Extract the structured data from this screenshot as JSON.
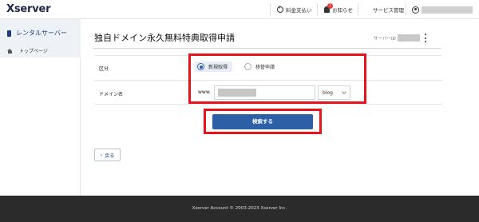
{
  "header": {
    "logo": "Xserver",
    "billing_label": "料金支払い",
    "billing_icon": "coin-icon",
    "notice_label": "お知らせ",
    "notice_badge": "1",
    "notice_icon": "bell-icon",
    "services_label": "サービス管理",
    "services_icon": "grid-icon",
    "user_icon": "user-icon"
  },
  "sidebar": {
    "section_label": "レンタルサーバー",
    "section_icon": "book-icon",
    "items": [
      {
        "label": "トップページ",
        "icon": "home-icon"
      }
    ]
  },
  "main": {
    "title": "独自ドメイン永久無料特典取得申請",
    "server_id_label": "サーバーID",
    "form": {
      "kind_label": "区分",
      "options": [
        {
          "label": "新規取得",
          "selected": true
        },
        {
          "label": "移管申請",
          "selected": false
        }
      ],
      "domain_label": "ドメイン名",
      "domain_prefix": "www.",
      "domain_value": "",
      "tld_selected": "blog"
    },
    "search_button": "検索する",
    "back_button": "戻る",
    "back_icon": "chevron-left-icon"
  },
  "footer": {
    "copyright": "Xserver Account © 2003-2023 Xserver Inc."
  },
  "colors": {
    "brand": "#1a2744",
    "primary_button": "#2d5fa6",
    "annotation": "#e8121b",
    "footer_bg": "#2b2b2b"
  }
}
